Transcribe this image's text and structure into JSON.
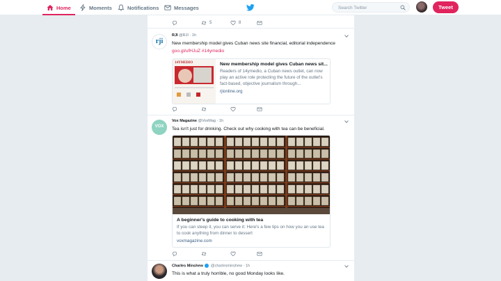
{
  "nav": {
    "home": "Home",
    "moments": "Moments",
    "notifications": "Notifications",
    "messages": "Messages",
    "search_placeholder": "Search Twitter",
    "tweet_button": "Tweet",
    "accent_color": "#e0245e"
  },
  "top_stub": {
    "retweets": "5",
    "likes": "8"
  },
  "tweets": [
    {
      "name": "RJI",
      "handle": "@RJI",
      "time": "1h",
      "text": "New membership model gives Cuban news site financial, editorial independence",
      "link_text": "goo.gl/ufHJuZ #14ymedio",
      "card": {
        "title": "New membership model gives Cuban news sit...",
        "description": "Readers of 14ymedio, a Cuban news outlet, can now play an active role protecting the future of the outlet's fact-based, objective journalism through...",
        "domain": "rjionline.org",
        "thumb_brand": "14YMEDIO"
      },
      "avatar_text": "rji"
    },
    {
      "name": "Vox Magazine",
      "handle": "@VoxMag",
      "time": "1h",
      "text": "Tea isn't just for drinking. Check out why cooking with tea can be beneficial.",
      "card": {
        "title": "A beginner's guide to cooking with tea",
        "description": "If you can steep it, you can serve it: Here's a few tips on how you an use tea to cook anything from dinner to dessert",
        "domain": "voxmagazine.com"
      },
      "avatar_text": "VOX"
    },
    {
      "name": "Charles Minshew",
      "handle": "@charlesminshew",
      "time": "1h",
      "text": "This is what a truly horrible, no good Monday looks like."
    }
  ]
}
